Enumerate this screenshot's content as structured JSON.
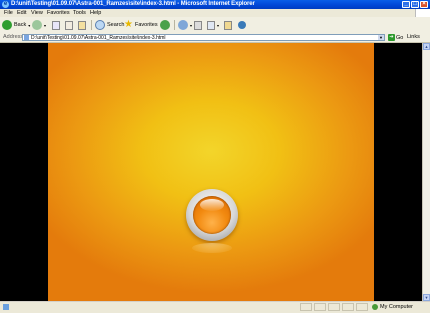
{
  "window": {
    "title": "D:\\unit\\Testing\\01.09.07\\Astra-001_Ramzes\\site\\index-3.html - Microsoft Internet Explorer",
    "min_label": "_",
    "max_label": "□",
    "close_label": "×"
  },
  "menu": [
    "File",
    "Edit",
    "View",
    "Favorites",
    "Tools",
    "Help"
  ],
  "toolbar": {
    "back_label": "Back",
    "search_label": "Search",
    "favorites_label": "Favorites"
  },
  "address": {
    "label": "Address",
    "value": "D:\\unit\\Testing\\01.09.07\\Astra-001_Ramzes\\site\\index-3.html",
    "go_label": "Go",
    "links_label": "Links"
  },
  "status": {
    "zone_label": "My Computer"
  },
  "colors": {
    "title_bar": "#0054e3",
    "stage_center": "#f3d52a",
    "stage_edge": "#e47b0c",
    "orb": "#f28a10"
  }
}
